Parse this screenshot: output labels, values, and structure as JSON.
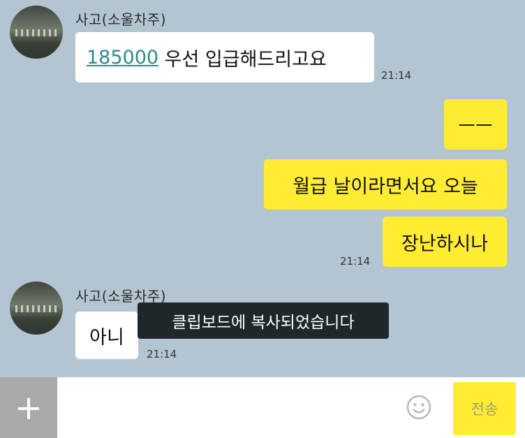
{
  "messages": {
    "group1": {
      "sender": "사고(소울차주)",
      "amount": "185000",
      "text": " 우선 입급해드리고요",
      "time": "21:14"
    },
    "group2": {
      "msg1": "ㅡㅡ",
      "msg2": "월급 날이라면서요 오늘",
      "msg3": "장난하시나",
      "time": "21:14"
    },
    "group3": {
      "sender": "사고(소울차주)",
      "text": "아니",
      "time": "21:14"
    }
  },
  "toast": "클립보드에 복사되었습니다",
  "input_bar": {
    "plus_label": "+",
    "send_label": "전송"
  },
  "icons": [
    "avatar-image",
    "plus-icon",
    "emoji-icon"
  ],
  "colors": {
    "chat_background": "#b4c5d2",
    "my_bubble": "#ffec33",
    "their_bubble": "#ffffff",
    "link": "#2f8a86"
  }
}
